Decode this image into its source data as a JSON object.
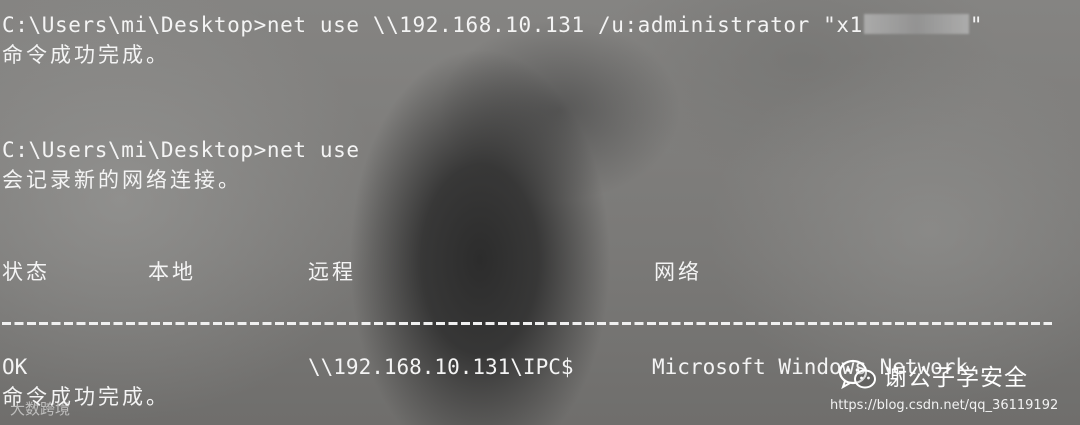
{
  "terminal": {
    "prompt1": "C:\\Users\\mi\\Desktop>",
    "command1_visible": "net use \\\\192.168.10.131 /u:administrator \"x1",
    "command1_end": "\"",
    "result1": "命令成功完成。",
    "prompt2": "C:\\Users\\mi\\Desktop>",
    "command2": "net use",
    "info": "会记录新的网络连接。",
    "headers": {
      "status": "状态",
      "local": "本地",
      "remote": "远程",
      "network": "网络"
    },
    "row": {
      "status": "OK",
      "local": "",
      "remote": "\\\\192.168.10.131\\IPC$",
      "network": "Microsoft Windows Network"
    },
    "result2": "命令成功完成。"
  },
  "watermark": {
    "wechat_label": "谢公子学安全",
    "url": "https://blog.csdn.net/qq_36119192",
    "corner": "大数跨境"
  },
  "colors": {
    "text": "#f4f4f4",
    "background": "#7d7c7a"
  }
}
